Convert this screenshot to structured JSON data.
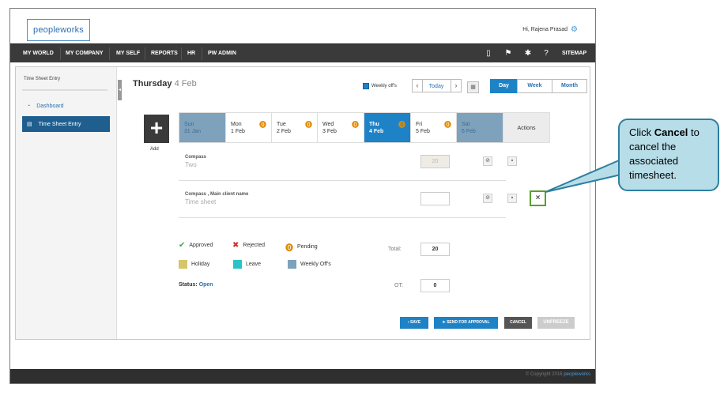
{
  "app": {
    "logo": "peopleworks",
    "greeting": "Hi, Rajena Prasad",
    "footer_copyright": "© Copyright 2016",
    "footer_brand": "peopleworks"
  },
  "nav": {
    "items": [
      "MY WORLD",
      "MY COMPANY",
      "MY SELF",
      "REPORTS",
      "HR",
      "PW ADMIN"
    ],
    "sitemap": "SITEMAP"
  },
  "sidebar": {
    "title": "Time Sheet Entry",
    "items": [
      "Dashboard",
      "Time Sheet Entry"
    ]
  },
  "main": {
    "day_title": "Thursday",
    "day_date": "4 Feb",
    "weekly_offs_label": "Weekly off's",
    "today_label": "Today",
    "views": [
      "Day",
      "Week",
      "Month"
    ],
    "add_label": "Add",
    "days": [
      {
        "name": "Sun",
        "date": "31 Jan"
      },
      {
        "name": "Mon",
        "date": "1 Feb"
      },
      {
        "name": "Tue",
        "date": "2 Feb"
      },
      {
        "name": "Wed",
        "date": "3 Feb"
      },
      {
        "name": "Thu",
        "date": "4 Feb"
      },
      {
        "name": "Fri",
        "date": "5 Feb"
      },
      {
        "name": "Sat",
        "date": "6 Feb"
      }
    ],
    "actions_label": "Actions",
    "rows": [
      {
        "project": "Compass",
        "task": "Two",
        "value": "20"
      },
      {
        "project": "Compass , Main client name",
        "task": "Time sheet",
        "value": ""
      }
    ],
    "legend": {
      "approved": "Approved",
      "rejected": "Rejected",
      "pending": "Pending",
      "holiday": "Holiday",
      "leave": "Leave",
      "weekly_offs": "Weekly Off's"
    },
    "status_label": "Status:",
    "status_value": "Open",
    "total_label": "Total:",
    "total_value": "20",
    "ot_label": "OT:",
    "ot_value": "0",
    "buttons": {
      "save": "SAVE",
      "send": "SEND FOR APPROVAL",
      "cancel": "CANCEL",
      "unfreeze": "UNFREEZE"
    }
  },
  "callout": {
    "prefix": "Click ",
    "bold": "Cancel",
    "suffix": " to cancel the associated timesheet."
  },
  "colors": {
    "accent": "#1e82c6",
    "approved": "#3ea84a",
    "rejected": "#d12f2f",
    "pending": "#e08b00",
    "holiday": "#d6c56a",
    "leave": "#29c3c8",
    "weekly_off": "#7fa2bc",
    "callout_bg": "#b7dde8"
  }
}
